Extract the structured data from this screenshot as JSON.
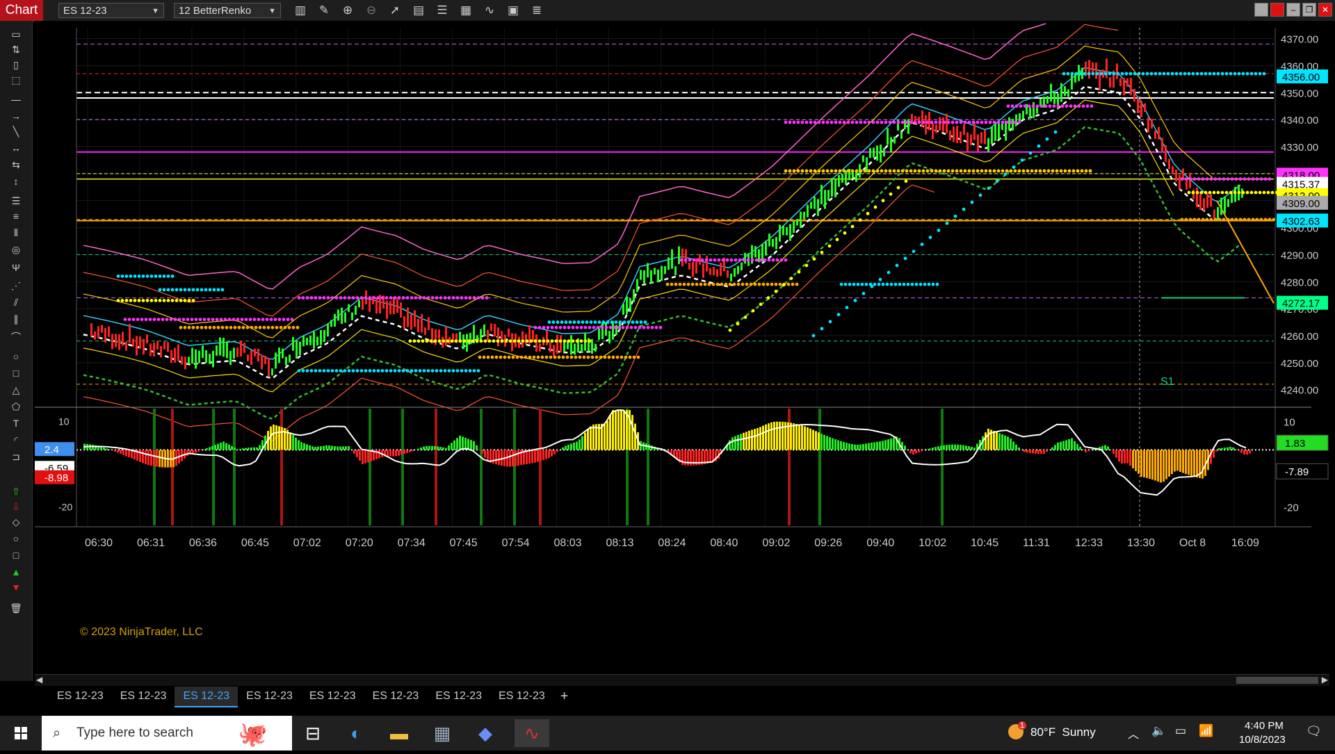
{
  "app": {
    "tab_label": "Chart"
  },
  "toolbar": {
    "instrument": "ES 12-23",
    "bar_type": "12 BetterRenko",
    "icons": [
      "bars-type-icon",
      "draw-tool-icon",
      "zoom-in-icon",
      "zoom-out-icon",
      "pointer-icon",
      "data-box-icon",
      "properties-icon",
      "strategies-icon",
      "indicators-icon",
      "list-icon"
    ]
  },
  "price_axis": {
    "ticks": [
      "4370.00",
      "4360.00",
      "4350.00",
      "4340.00",
      "4330.00",
      "4320.00",
      "4310.00",
      "4300.00",
      "4290.00",
      "4280.00",
      "4270.00",
      "4260.00",
      "4250.00",
      "4240.00"
    ],
    "markers": [
      {
        "label": "4356.00",
        "color": "#00e5ff",
        "text_color": "#000"
      },
      {
        "label": "4318.00",
        "color": "#ff33ff",
        "text_color": "#000"
      },
      {
        "label": "4315.37",
        "color": "#ffffff",
        "text_color": "#000"
      },
      {
        "label": "4312.00",
        "color": "#ffff00",
        "text_color": "#000"
      },
      {
        "label": "4309.00",
        "color": "#aaaaaa",
        "text_color": "#000"
      },
      {
        "label": "4302.63",
        "color": "#00e5ff",
        "text_color": "#000"
      },
      {
        "label": "4272.17",
        "color": "#00ff88",
        "text_color": "#000"
      }
    ],
    "s1_label": "S1",
    "range": [
      4234,
      4374
    ]
  },
  "indicator_axis": {
    "ticks": [
      "10",
      "-20"
    ],
    "left_ticks": [
      "10",
      "0",
      "-20"
    ],
    "markers": [
      {
        "label": "1.83",
        "color": "#22dd22",
        "text_color": "#000"
      },
      {
        "label": "-7.89",
        "color": "#000000",
        "text_color": "#fff"
      }
    ],
    "left_markers": [
      {
        "label": "2.4",
        "color": "#3f8ef0",
        "text_color": "#fff"
      },
      {
        "label": "-6.59",
        "color": "#ffffff",
        "text_color": "#000"
      },
      {
        "label": "-8.98",
        "color": "#e01010",
        "text_color": "#fff"
      }
    ]
  },
  "copyright": "© 2023 NinjaTrader, LLC",
  "time_axis": [
    "06:30",
    "06:31",
    "06:36",
    "06:45",
    "07:02",
    "07:20",
    "07:34",
    "07:45",
    "07:54",
    "08:03",
    "08:13",
    "08:24",
    "08:40",
    "09:02",
    "09:26",
    "09:40",
    "10:02",
    "10:45",
    "11:31",
    "12:33",
    "13:30",
    "Oct 8",
    "16:09"
  ],
  "chart_tabs": [
    "ES 12-23",
    "ES 12-23",
    "ES 12-23",
    "ES 12-23",
    "ES 12-23",
    "ES 12-23",
    "ES 12-23",
    "ES 12-23"
  ],
  "active_tab_index": 2,
  "taskbar": {
    "search_placeholder": "Type here to search",
    "weather": "80°F  Sunny",
    "time": "4:40 PM",
    "date": "10/8/2023",
    "weather_badge": "1"
  },
  "colors": {
    "accent_red": "#b5121b",
    "up": "#22ff22",
    "down": "#ff2222"
  }
}
